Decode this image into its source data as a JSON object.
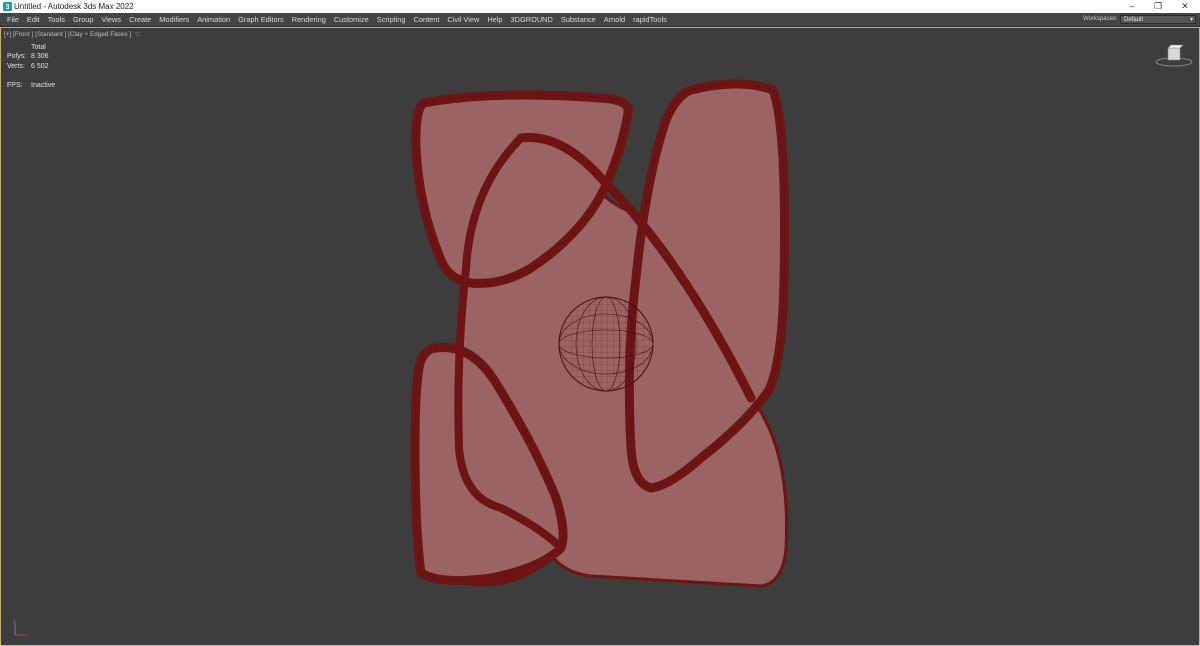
{
  "window": {
    "title": "Untitled - Autodesk 3ds Max 2022",
    "controls": {
      "minimize": "–",
      "restore": "❐",
      "close": "✕"
    }
  },
  "menubar": {
    "items": [
      "File",
      "Edit",
      "Tools",
      "Group",
      "Views",
      "Create",
      "Modifiers",
      "Animation",
      "Graph Editors",
      "Rendering",
      "Customize",
      "Scripting",
      "Content",
      "Civil View",
      "Help",
      "3DGROUND",
      "Substance",
      "Arnold",
      "rapidTools"
    ],
    "workspaces_label": "Workspaces:",
    "workspace_value": "Default"
  },
  "viewport": {
    "label": "[+] [Front ] [Standard ] [Clay + Edged Faces ]",
    "stats": {
      "header": "Total",
      "polys_label": "Polys:",
      "polys_value": "8 306",
      "verts_label": "Verts:",
      "verts_value": "6 502",
      "fps_label": "FPS:",
      "fps_value": "Inactive"
    },
    "colors": {
      "background": "#3d3d3d",
      "active_border": "#c6b26a",
      "object_fill": "#9b6464",
      "object_edge": "#6e1414",
      "wire": "#4a0c0c"
    }
  }
}
